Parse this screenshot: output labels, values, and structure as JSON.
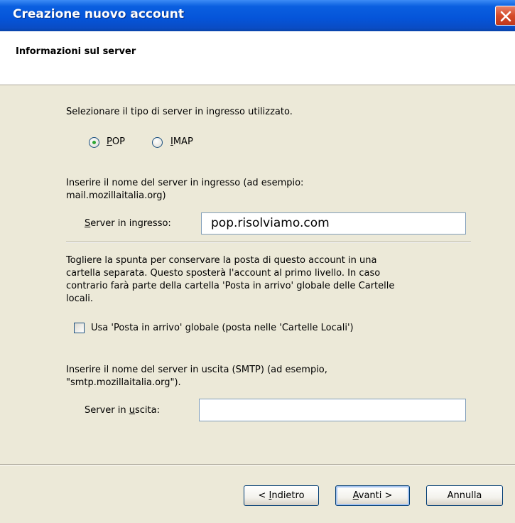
{
  "window": {
    "title": "Creazione nuovo account"
  },
  "header": {
    "title": "Informazioni sul server"
  },
  "server_type": {
    "prompt": "Selezionare il tipo di server in ingresso utilizzato.",
    "options": [
      {
        "label": "POP",
        "selected": true
      },
      {
        "label": "IMAP",
        "selected": false
      }
    ]
  },
  "incoming": {
    "description_line1": "Inserire il nome del server in ingresso (ad esempio:",
    "description_line2": "mail.mozillaitalia.org)",
    "label": "Server in ingresso:",
    "value": "pop.risolviamo.com"
  },
  "global_inbox": {
    "description_line1": "Togliere la spunta per conservare la posta di questo account in una",
    "description_line2": "cartella separata. Questo sposterà l'account al primo livello. In caso",
    "description_line3": "contrario farà parte della cartella 'Posta in arrivo' globale delle Cartelle",
    "description_line4": "locali.",
    "checkbox_label": "Usa 'Posta in arrivo' globale (posta nelle 'Cartelle Locali')",
    "checked": false
  },
  "outgoing": {
    "description_line1": "Inserire il nome del server in uscita (SMTP) (ad esempio,",
    "description_line2": "\"smtp.mozillaitalia.org\").",
    "label": "Server in uscita:",
    "value": ""
  },
  "buttons": {
    "back": "< Indietro",
    "next": "Avanti >",
    "cancel": "Annulla"
  }
}
